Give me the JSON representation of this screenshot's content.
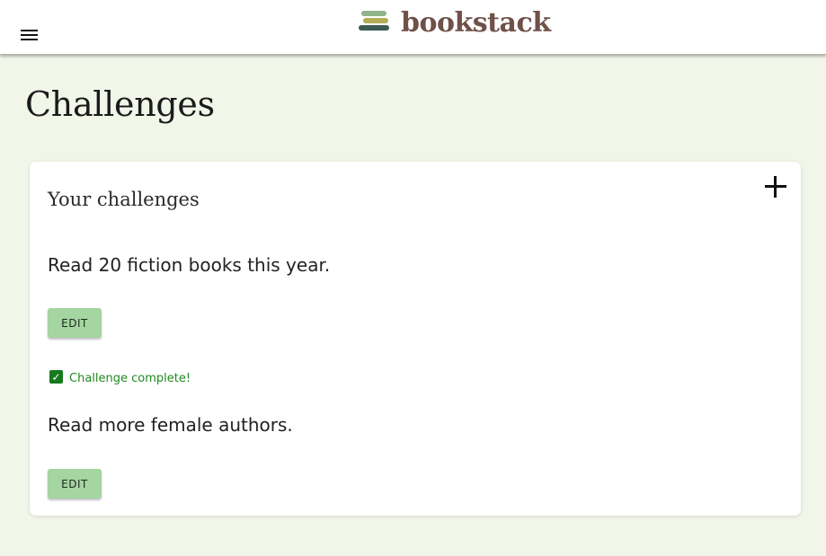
{
  "header": {
    "brand_name": "bookstack",
    "logo_colors": [
      "#8fb38a",
      "#b5ad57",
      "#3e5a55"
    ]
  },
  "page": {
    "title": "Challenges"
  },
  "card": {
    "heading": "Your challenges",
    "add_icon": "plus-icon",
    "challenges": [
      {
        "text": "Read 20 fiction books this year.",
        "edit_label": "EDIT",
        "completed": true,
        "complete_label": "Challenge complete!"
      },
      {
        "text": "Read more female authors.",
        "edit_label": "EDIT",
        "completed": false
      }
    ]
  },
  "colors": {
    "background": "#f1f6e9",
    "edit_button": "#a5d5a1",
    "complete_green": "#1f8a1f",
    "brand_text": "#6f5149"
  }
}
